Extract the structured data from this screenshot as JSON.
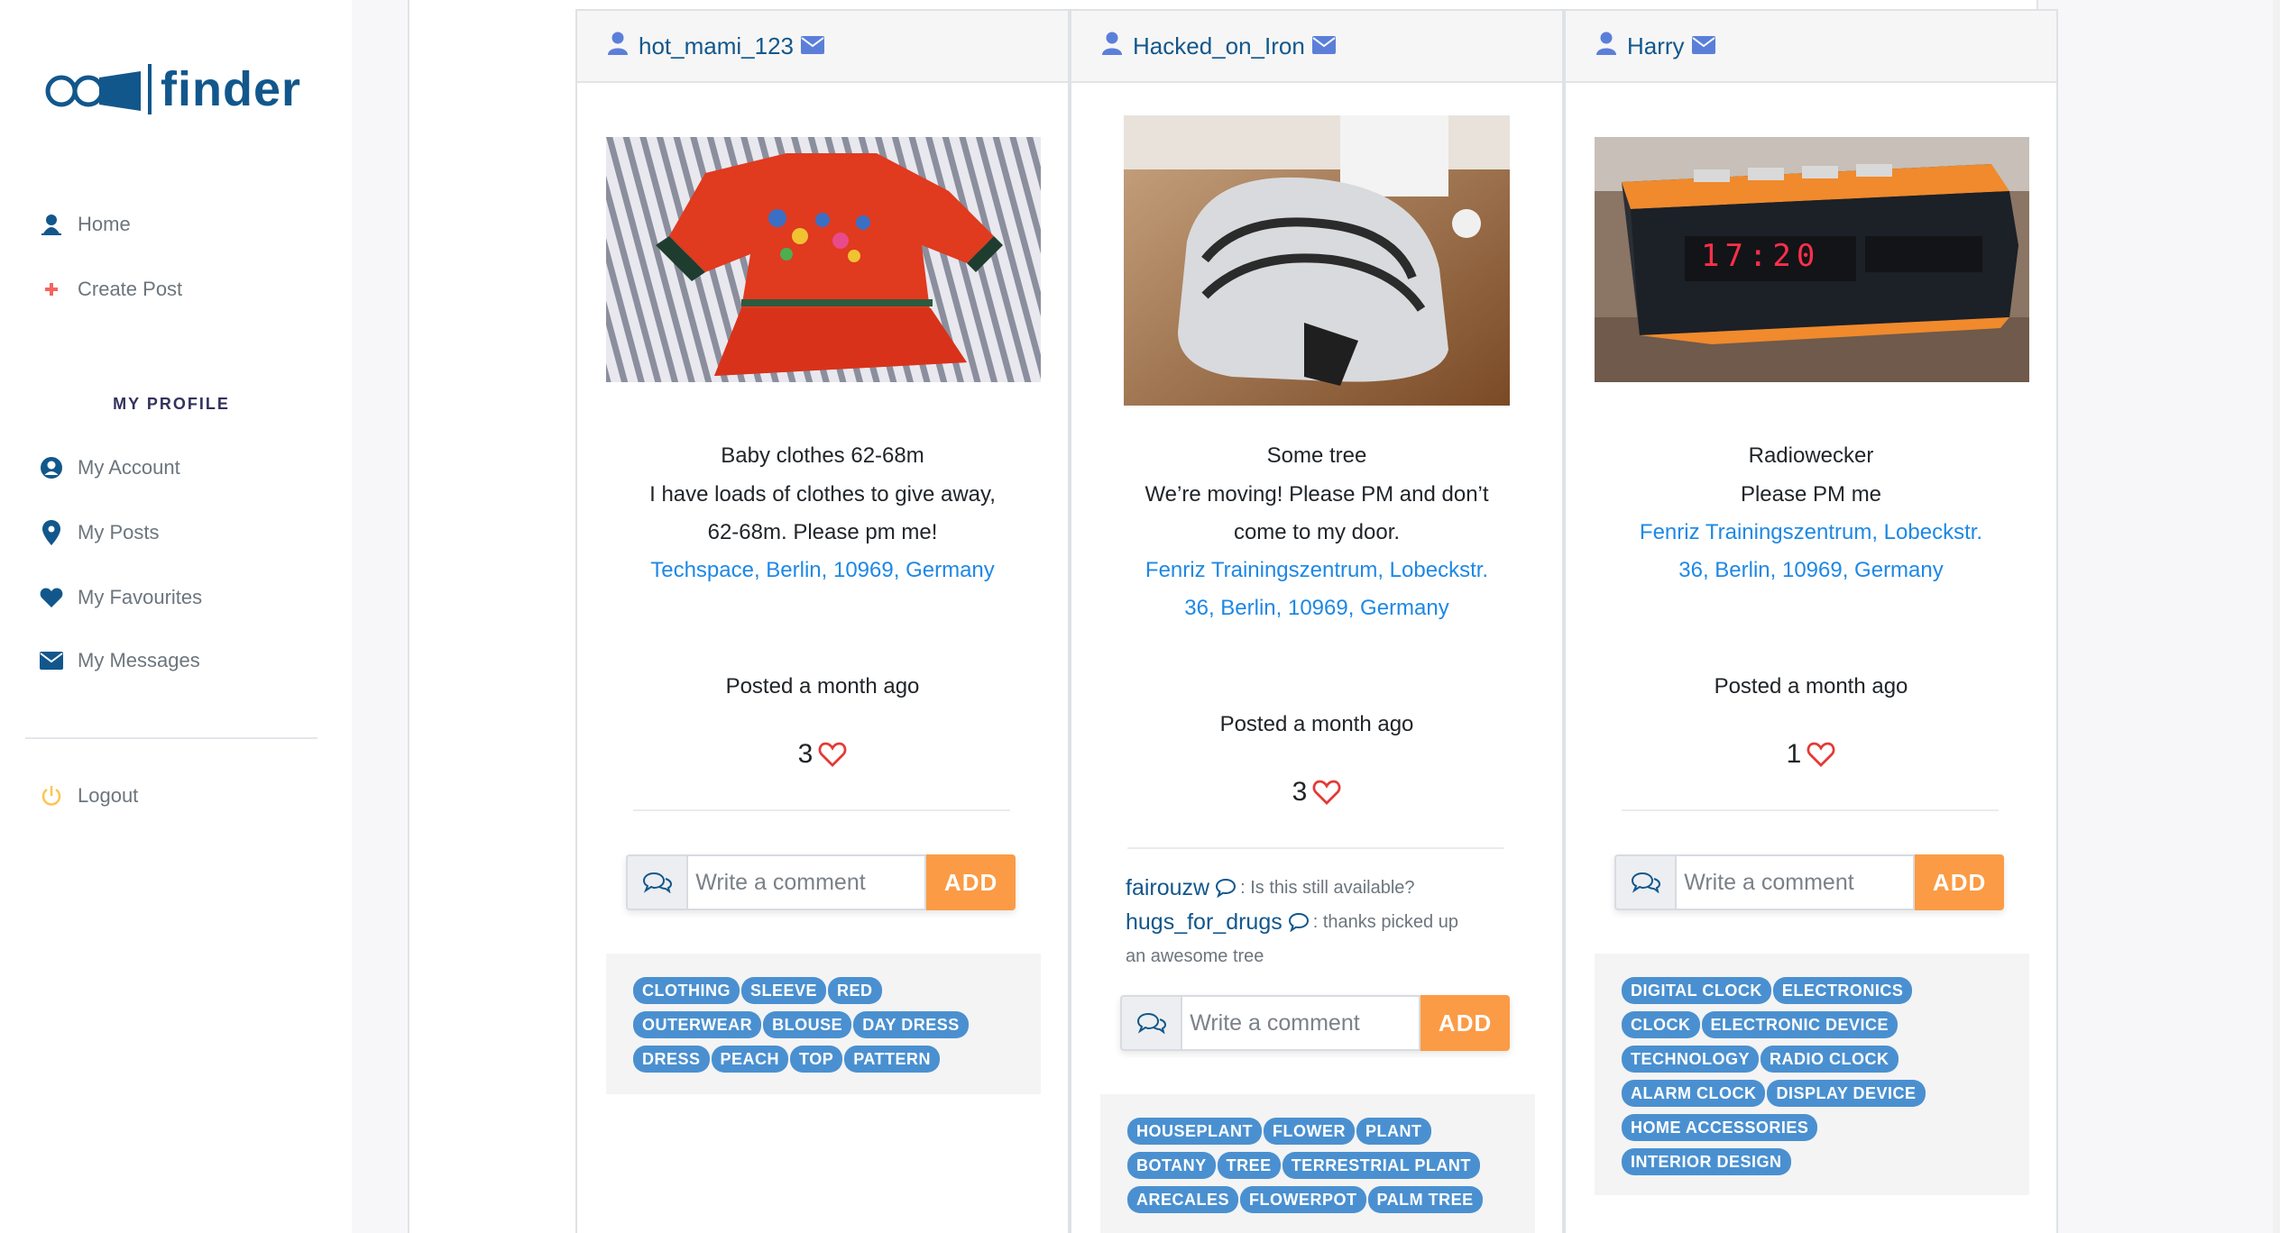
{
  "app": {
    "logo_text": "finder",
    "colors": {
      "brand": "#12578c",
      "accent": "#fb9b45",
      "link": "#1e88e5",
      "tag": "#4a90d0",
      "heart": "#e53935"
    }
  },
  "sidebar": {
    "nav": [
      {
        "label": "Home",
        "icon": "map-pin-person-icon"
      },
      {
        "label": "Create Post",
        "icon": "plus-icon"
      }
    ],
    "section_title": "MY PROFILE",
    "profile_nav": [
      {
        "label": "My Account",
        "icon": "user-circle-icon"
      },
      {
        "label": "My Posts",
        "icon": "map-marker-icon"
      },
      {
        "label": "My Favourites",
        "icon": "heart-icon"
      },
      {
        "label": "My Messages",
        "icon": "envelope-icon"
      }
    ],
    "logout": {
      "label": "Logout",
      "icon": "power-icon"
    }
  },
  "posts": [
    {
      "username": "hot_mami_123",
      "title": "Baby clothes 62-68m",
      "description_lines": [
        "I have loads of clothes to give away,",
        "62-68m. Please pm me!"
      ],
      "location_lines": [
        "Techspace, Berlin, 10969, Germany"
      ],
      "posted": "Posted a month ago",
      "likes": "3",
      "comments": [],
      "comment_placeholder": "Write a comment",
      "add_label": "ADD",
      "tag_rows": [
        [
          "CLOTHING",
          "SLEEVE",
          "RED"
        ],
        [
          "OUTERWEAR",
          "BLOUSE",
          "DAY DRESS"
        ],
        [
          "DRESS",
          "PEACH",
          "TOP",
          "PATTERN"
        ]
      ]
    },
    {
      "username": "Hacked_on_Iron",
      "title": "Some tree",
      "description_lines": [
        "We’re moving! Please PM and don’t",
        "come to my door."
      ],
      "location_lines": [
        "Fenriz Trainingszentrum, Lobeckstr.",
        "36, Berlin, 10969, Germany"
      ],
      "posted": "Posted a month ago",
      "likes": "3",
      "comments": [
        {
          "user": "fairouzw",
          "text": ": Is this still available?"
        },
        {
          "user": "hugs_for_drugs",
          "text": ": thanks picked up",
          "cont": "an awesome tree"
        }
      ],
      "comment_placeholder": "Write a comment",
      "add_label": "ADD",
      "tag_rows": [
        [
          "HOUSEPLANT",
          "FLOWER",
          "PLANT"
        ],
        [
          "BOTANY",
          "TREE",
          "TERRESTRIAL PLANT"
        ],
        [
          "ARECALES",
          "FLOWERPOT",
          "PALM TREE"
        ]
      ]
    },
    {
      "username": "Harry",
      "title": "Radiowecker",
      "description_lines": [
        "Please PM me"
      ],
      "location_lines": [
        "Fenriz Trainingszentrum, Lobeckstr.",
        "36, Berlin, 10969, Germany"
      ],
      "posted": "Posted a month ago",
      "likes": "1",
      "comments": [],
      "comment_placeholder": "Write a comment",
      "add_label": "ADD",
      "clock_display": "17:20",
      "tag_rows": [
        [
          "DIGITAL CLOCK",
          "ELECTRONICS"
        ],
        [
          "CLOCK",
          "ELECTRONIC DEVICE"
        ],
        [
          "TECHNOLOGY",
          "RADIO CLOCK"
        ],
        [
          "ALARM CLOCK",
          "DISPLAY DEVICE"
        ],
        [
          "HOME ACCESSORIES"
        ],
        [
          "INTERIOR DESIGN"
        ]
      ]
    }
  ]
}
